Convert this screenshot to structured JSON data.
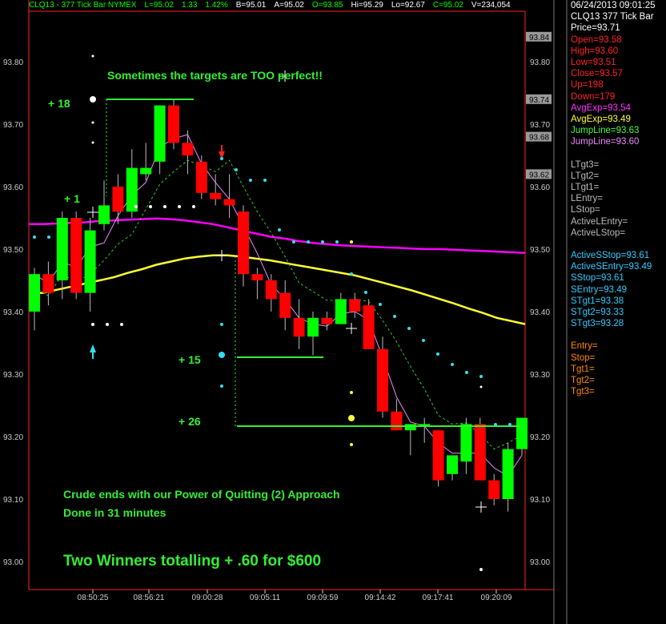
{
  "header": {
    "symbol": "CLQ13 - 377 Tick Bar  NYMEX",
    "last": "L=95.02",
    "change": "1.33",
    "pct": "1.42%",
    "bid": "B=95.01",
    "ask": "A=95.02",
    "open": "O=93.85",
    "high": "Hi=95.29",
    "low": "Lo=92.67",
    "close": "C=95.02",
    "volume": "V=234,054"
  },
  "annotations": {
    "targets_note": "Sometimes the targets are TOO perfect!!",
    "plus18": "+ 18",
    "plus1": "+ 1",
    "plus15": "+ 15",
    "plus26": "+ 26",
    "crude_ends": "Crude ends with our Power of Quitting (2) Approach",
    "done_in": "Done in 31 minutes",
    "winners": "Two Winners totalling + .60 for $600"
  },
  "panel": {
    "datetime": "06/24/2013 09:01:25",
    "title": "CLQ13 377 Tick Bar",
    "price": "Price=93.71",
    "open": "Open=93.58",
    "high": "High=93.60",
    "low": "Low=93.51",
    "close": "Close=93.57",
    "up": "Up=198",
    "down": "Down=179",
    "avgexp1": "AvgExp=93.54",
    "avgexp2": "AvgExp=93.49",
    "jump1": "JumpLine=93.63",
    "jump2": "JumpLine=93.60",
    "ltgt3": "LTgt3=",
    "ltgt2": "LTgt2=",
    "ltgt1": "LTgt1=",
    "lentry": "LEntry=",
    "lstop": "LStop=",
    "activelentry": "ActiveLEntry=",
    "activelstop": "ActiveLStop=",
    "activesstop": "ActiveSStop=93.61",
    "activesentry": "ActiveSEntry=93.49",
    "sstop": "SStop=93.61",
    "sentry": "SEntry=93.49",
    "stgt1": "STgt1=93.38",
    "stgt2": "STgt2=93.33",
    "stgt3": "STgt3=93.28",
    "entry": "Entry=",
    "stop": "Stop=",
    "tgt1": "Tgt1=",
    "tgt2": "Tgt2=",
    "tgt3": "Tgt3="
  },
  "colors": {
    "up": "#00ff00",
    "down": "#ff0000",
    "avg_magenta": "#ff00ff",
    "avg_yellow": "#ffff33",
    "cyan_dots": "#33ddee",
    "frame": "#ff2222"
  },
  "chart_data": {
    "type": "candlestick",
    "ylim": [
      92.9,
      93.87
    ],
    "yticks": [
      "93.80",
      "93.70",
      "93.60",
      "93.50",
      "93.40",
      "93.30",
      "93.20",
      "93.10",
      "93.00"
    ],
    "xticks": [
      "08:50:25",
      "08:56:21",
      "09:00:28",
      "09:05:11",
      "09:09:59",
      "09:14:42",
      "09:17:41",
      "09:20:09"
    ],
    "price_tags": [
      "93.84",
      "93.74",
      "93.68",
      "93.62"
    ],
    "candles": [
      {
        "o": 93.4,
        "h": 93.47,
        "l": 93.37,
        "c": 93.46
      },
      {
        "o": 93.46,
        "h": 93.48,
        "l": 93.41,
        "c": 93.43
      },
      {
        "o": 93.45,
        "h": 93.56,
        "l": 93.42,
        "c": 93.55
      },
      {
        "o": 93.55,
        "h": 93.56,
        "l": 93.42,
        "c": 93.43
      },
      {
        "o": 93.43,
        "h": 93.55,
        "l": 93.4,
        "c": 93.53
      },
      {
        "o": 93.54,
        "h": 93.61,
        "l": 93.53,
        "c": 93.57
      },
      {
        "o": 93.6,
        "h": 93.62,
        "l": 93.54,
        "c": 93.56
      },
      {
        "o": 93.56,
        "h": 93.66,
        "l": 93.55,
        "c": 93.63
      },
      {
        "o": 93.62,
        "h": 93.67,
        "l": 93.61,
        "c": 93.63
      },
      {
        "o": 93.64,
        "h": 93.73,
        "l": 93.62,
        "c": 93.73
      },
      {
        "o": 93.73,
        "h": 93.74,
        "l": 93.66,
        "c": 93.67
      },
      {
        "o": 93.67,
        "h": 93.69,
        "l": 93.62,
        "c": 93.65
      },
      {
        "o": 93.64,
        "h": 93.65,
        "l": 93.58,
        "c": 93.59
      },
      {
        "o": 93.59,
        "h": 93.62,
        "l": 93.57,
        "c": 93.58
      },
      {
        "o": 93.58,
        "h": 93.62,
        "l": 93.55,
        "c": 93.57
      },
      {
        "o": 93.56,
        "h": 93.57,
        "l": 93.44,
        "c": 93.46
      },
      {
        "o": 93.46,
        "h": 93.47,
        "l": 93.42,
        "c": 93.45
      },
      {
        "o": 93.45,
        "h": 93.46,
        "l": 93.4,
        "c": 93.42
      },
      {
        "o": 93.43,
        "h": 93.45,
        "l": 93.37,
        "c": 93.39
      },
      {
        "o": 93.39,
        "h": 93.42,
        "l": 93.34,
        "c": 93.36
      },
      {
        "o": 93.36,
        "h": 93.4,
        "l": 93.33,
        "c": 93.39
      },
      {
        "o": 93.39,
        "h": 93.4,
        "l": 93.37,
        "c": 93.38
      },
      {
        "o": 93.38,
        "h": 93.43,
        "l": 93.38,
        "c": 93.42
      },
      {
        "o": 93.42,
        "h": 93.43,
        "l": 93.39,
        "c": 93.4
      },
      {
        "o": 93.41,
        "h": 93.42,
        "l": 93.34,
        "c": 93.34
      },
      {
        "o": 93.34,
        "h": 93.36,
        "l": 93.23,
        "c": 93.24
      },
      {
        "o": 93.24,
        "h": 93.26,
        "l": 93.21,
        "c": 93.21
      },
      {
        "o": 93.21,
        "h": 93.22,
        "l": 93.17,
        "c": 93.22
      },
      {
        "o": 93.22,
        "h": 93.23,
        "l": 93.19,
        "c": 93.22
      },
      {
        "o": 93.21,
        "h": 93.21,
        "l": 93.12,
        "c": 93.13
      },
      {
        "o": 93.14,
        "h": 93.17,
        "l": 93.13,
        "c": 93.17
      },
      {
        "o": 93.16,
        "h": 93.23,
        "l": 93.14,
        "c": 93.22
      },
      {
        "o": 93.22,
        "h": 93.23,
        "l": 93.13,
        "c": 93.13
      },
      {
        "o": 93.13,
        "h": 93.14,
        "l": 93.09,
        "c": 93.1
      },
      {
        "o": 93.1,
        "h": 93.19,
        "l": 93.08,
        "c": 93.18
      },
      {
        "o": 93.18,
        "h": 93.23,
        "l": 93.17,
        "c": 93.23
      }
    ],
    "avg_magenta": [
      93.54,
      93.54,
      93.541,
      93.542,
      93.543,
      93.545,
      93.546,
      93.547,
      93.548,
      93.549,
      93.548,
      93.546,
      93.543,
      93.54,
      93.535,
      93.53,
      93.525,
      93.52,
      93.517,
      93.513,
      93.51,
      93.508,
      93.506,
      93.505,
      93.504,
      93.503,
      93.502,
      93.501,
      93.5,
      93.5,
      93.499,
      93.498,
      93.497,
      93.496,
      93.495,
      93.494
    ],
    "avg_yellow": [
      93.43,
      93.43,
      93.435,
      93.44,
      93.445,
      93.45,
      93.455,
      93.462,
      93.468,
      93.475,
      93.48,
      93.485,
      93.488,
      93.49,
      93.49,
      93.488,
      93.485,
      93.482,
      93.478,
      93.474,
      93.47,
      93.466,
      93.462,
      93.458,
      93.452,
      93.446,
      93.44,
      93.434,
      93.427,
      93.42,
      93.413,
      93.405,
      93.398,
      93.39,
      93.385,
      93.38
    ]
  }
}
